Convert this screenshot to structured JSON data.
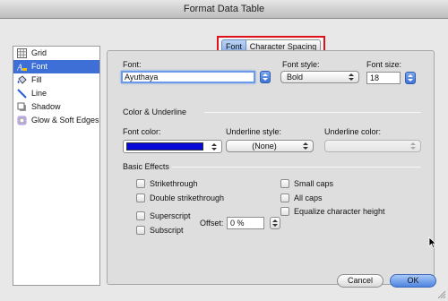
{
  "window": {
    "title": "Format Data Table"
  },
  "tabs": [
    {
      "label": "Font",
      "selected": true
    },
    {
      "label": "Character Spacing",
      "selected": false
    }
  ],
  "sidebar": {
    "items": [
      {
        "label": "Grid",
        "icon": "grid-icon",
        "selected": false
      },
      {
        "label": "Font",
        "icon": "font-icon",
        "selected": true
      },
      {
        "label": "Fill",
        "icon": "paint-bucket-icon",
        "selected": false
      },
      {
        "label": "Line",
        "icon": "line-icon",
        "selected": false
      },
      {
        "label": "Shadow",
        "icon": "shadow-icon",
        "selected": false
      },
      {
        "label": "Glow & Soft Edges",
        "icon": "glow-icon",
        "selected": false
      }
    ]
  },
  "font_section": {
    "font_label": "Font:",
    "font_value": "Ayuthaya",
    "style_label": "Font style:",
    "style_value": "Bold",
    "size_label": "Font size:",
    "size_value": "18"
  },
  "color_section": {
    "heading": "Color & Underline",
    "font_color_label": "Font color:",
    "font_color_value": "#0a0ad8",
    "underline_style_label": "Underline style:",
    "underline_style_value": "(None)",
    "underline_color_label": "Underline color:"
  },
  "effects": {
    "heading": "Basic Effects",
    "strikethrough": "Strikethrough",
    "double_strikethrough": "Double strikethrough",
    "superscript": "Superscript",
    "subscript": "Subscript",
    "offset_label": "Offset:",
    "offset_value": "0 %",
    "small_caps": "Small caps",
    "all_caps": "All caps",
    "equalize": "Equalize character height"
  },
  "buttons": {
    "cancel": "Cancel",
    "ok": "OK"
  },
  "colors": {
    "accent": "#3d6fd6",
    "highlight": "#e0101a"
  }
}
